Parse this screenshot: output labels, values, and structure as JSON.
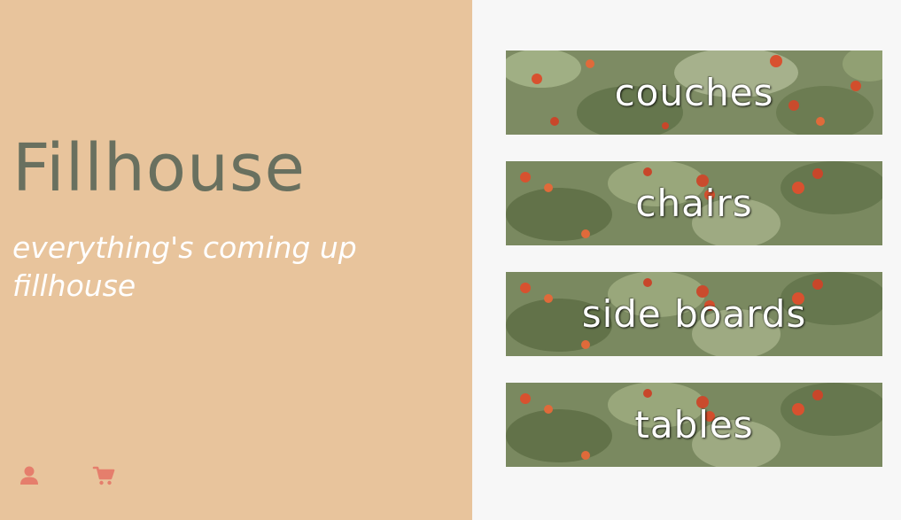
{
  "brand": {
    "title": "Fillhouse",
    "tagline": "everything's coming up fillhouse"
  },
  "nav": {
    "user_icon": "user-icon",
    "cart_icon": "shopping-cart-icon",
    "icon_color": "#e57e6c"
  },
  "categories": [
    {
      "label": "couches"
    },
    {
      "label": "chairs"
    },
    {
      "label": "side boards"
    },
    {
      "label": "tables"
    }
  ],
  "colors": {
    "left_panel": "#e8c49c",
    "right_panel": "#f7f7f7",
    "title": "#69705f",
    "tagline": "#ffffff"
  }
}
